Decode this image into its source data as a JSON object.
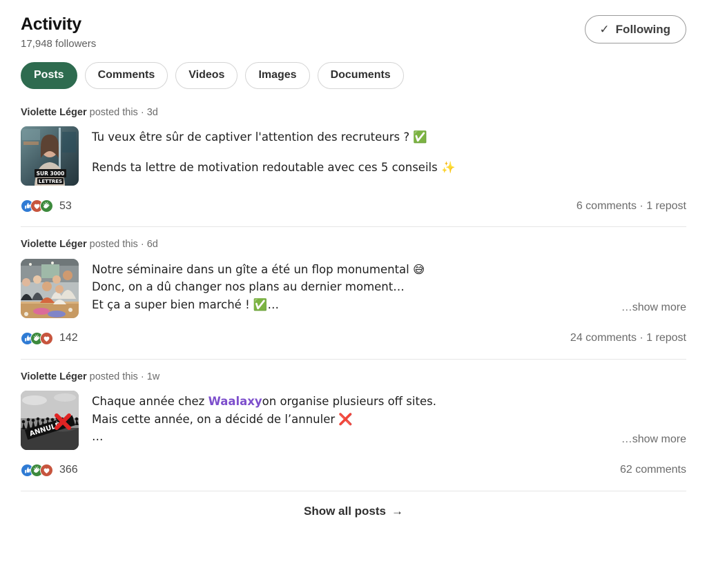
{
  "header": {
    "title": "Activity",
    "followers": "17,948 followers",
    "follow_button": {
      "label": "Following",
      "icon": "check-icon",
      "glyph": "✓"
    }
  },
  "filters": {
    "items": [
      {
        "label": "Posts",
        "active": true
      },
      {
        "label": "Comments",
        "active": false
      },
      {
        "label": "Videos",
        "active": false
      },
      {
        "label": "Images",
        "active": false
      },
      {
        "label": "Documents",
        "active": false
      }
    ],
    "active_color": "#2e6b4f"
  },
  "posts": [
    {
      "author": "Violette Léger",
      "meta_action": "posted this",
      "separator": "·",
      "age": "3d",
      "thumbnail": {
        "name": "video-thumbnail-letters",
        "caption_line1": "SUR 3000",
        "caption_line2": "LETTRES"
      },
      "lines": [
        "Tu veux être sûr de captiver l'attention des recruteurs ? ✅",
        "",
        "Rends ta lettre de motivation redoutable avec ces 5 conseils ✨"
      ],
      "show_more": "",
      "reactions": {
        "types": [
          "like",
          "love",
          "celebrate"
        ],
        "count": "53"
      },
      "social_stats": "6 comments · 1 repost"
    },
    {
      "author": "Violette Léger",
      "meta_action": "posted this",
      "separator": "·",
      "age": "6d",
      "thumbnail": {
        "name": "photo-thumbnail-seminar",
        "caption_line1": "",
        "caption_line2": ""
      },
      "lines": [
        "Notre séminaire dans un gîte a été un flop monumental 😅",
        "Donc, on a dû changer nos plans au dernier moment…",
        "Et ça a super bien marché ! ✅…"
      ],
      "show_more": "…show more",
      "reactions": {
        "types": [
          "like",
          "celebrate",
          "love"
        ],
        "count": "142"
      },
      "social_stats": "24 comments · 1 repost"
    },
    {
      "author": "Violette Léger",
      "meta_action": "posted this",
      "separator": "·",
      "age": "1w",
      "thumbnail": {
        "name": "photo-thumbnail-cancelled",
        "caption_line1": "ANNULÉ",
        "caption_line2": ""
      },
      "lines": [
        "Chaque année chez Waalaxyon organise plusieurs off sites.",
        "Mais cette année, on a décidé de l’annuler ❌",
        "…"
      ],
      "link_text": "Waalaxy",
      "link_color": "#7d4fcc",
      "line0_prefix": "Chaque année chez ",
      "line0_suffix": "on organise plusieurs off sites.",
      "show_more": "…show more",
      "reactions": {
        "types": [
          "like",
          "celebrate",
          "love"
        ],
        "count": "366"
      },
      "social_stats": "62 comments"
    }
  ],
  "footer": {
    "show_all_label": "Show all posts",
    "arrow": "→"
  }
}
